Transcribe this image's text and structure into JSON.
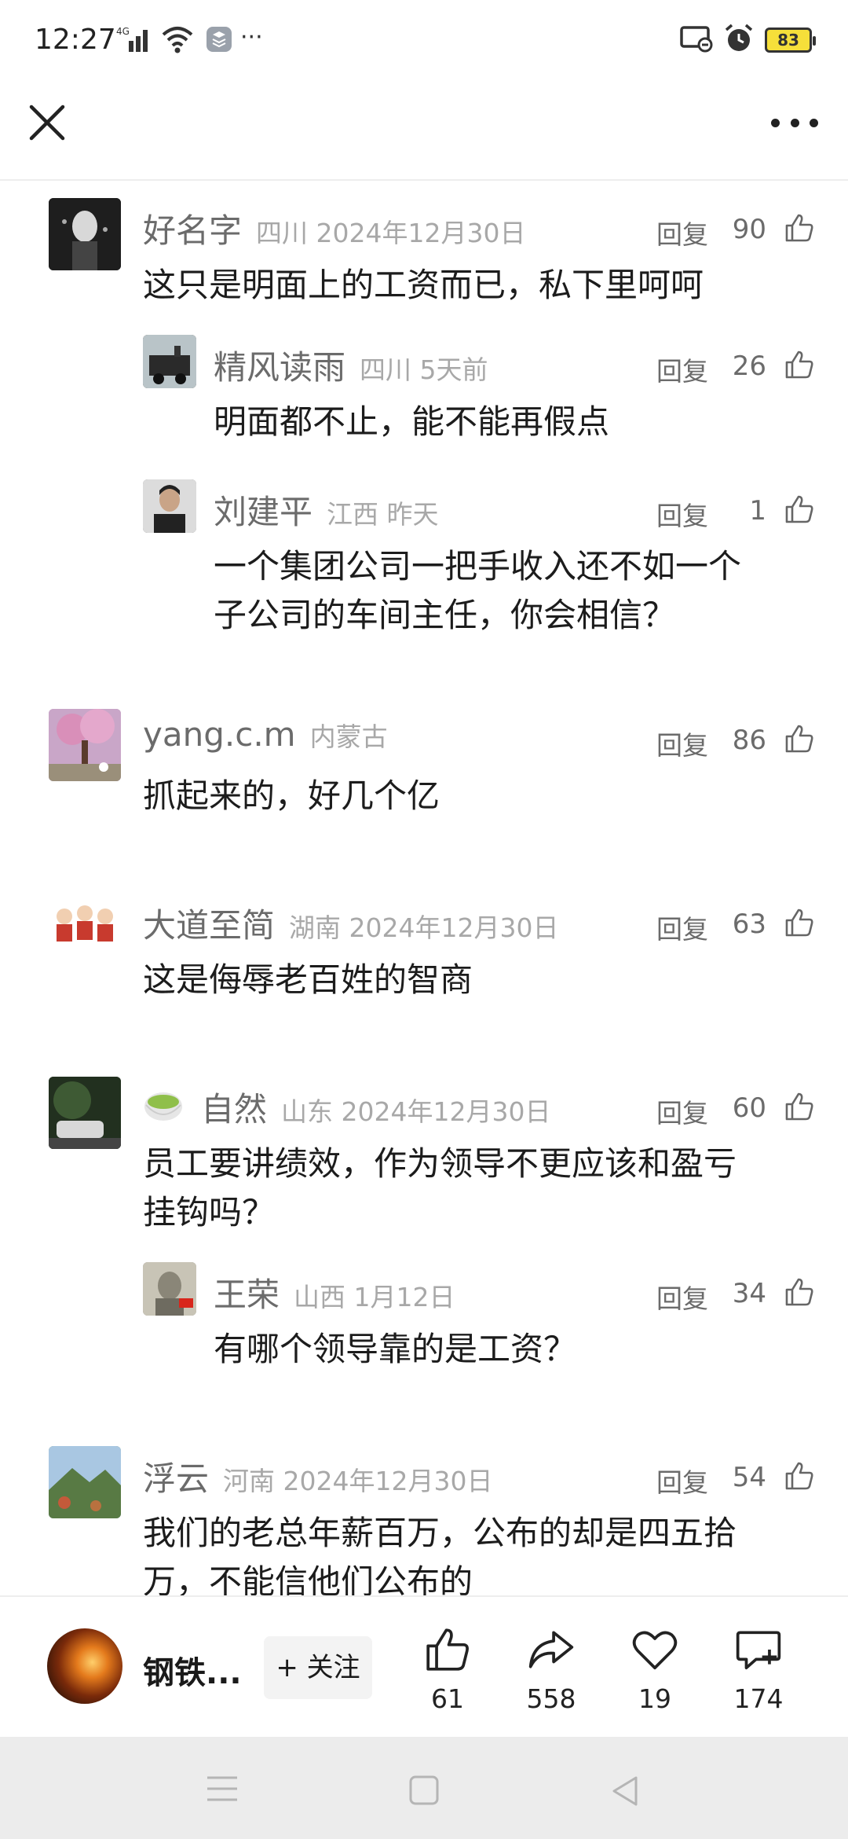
{
  "status_bar": {
    "time": "12:27",
    "network": "4G",
    "battery": "83"
  },
  "comments": [
    {
      "user": "好名字",
      "meta": "四川 2024年12月30日",
      "reply": "回复",
      "likes": "90",
      "text": "这只是明面上的工资而已，私下里呵呵",
      "is_reply": false,
      "avatar_color": "#2b2b2b"
    },
    {
      "user": "精风读雨",
      "meta": "四川 5天前",
      "reply": "回复",
      "likes": "26",
      "text": "明面都不止，能不能再假点",
      "is_reply": true,
      "avatar_color": "#5a4a3a"
    },
    {
      "user": "刘建平",
      "meta": "江西 昨天",
      "reply": "回复",
      "likes": "1",
      "text_lines": [
        "一个集团公司一把手收入还不如一个",
        "子公司的车间主任，你会相信？"
      ],
      "is_reply": true,
      "avatar_color": "#6e6e6e"
    },
    {
      "user": "yang.c.m",
      "meta": "内蒙古",
      "reply": "回复",
      "likes": "86",
      "text": "抓起来的，好几个亿",
      "is_reply": false,
      "avatar_color": "#b38ab0"
    },
    {
      "user": "大道至简",
      "meta": "湖南 2024年12月30日",
      "reply": "回复",
      "likes": "63",
      "text": "这是侮辱老百姓的智商",
      "is_reply": false,
      "avatar_color": "#c83a2e"
    },
    {
      "user": "自然",
      "meta": "山东 2024年12月30日",
      "reply": "回复",
      "likes": "60",
      "text_lines": [
        "员工要讲绩效，作为领导不更应该和盈亏",
        "挂钩吗？"
      ],
      "is_reply": false,
      "avatar_color": "#2f3a2c"
    },
    {
      "user": "王荣",
      "meta": "山西 1月12日",
      "reply": "回复",
      "likes": "34",
      "text": "有哪个领导靠的是工资？",
      "is_reply": true,
      "avatar_color": "#8b8a82"
    },
    {
      "user": "浮云",
      "meta": "河南 2024年12月30日",
      "reply": "回复",
      "likes": "54",
      "text_lines": [
        "我们的老总年薪百万，公布的却是四五拾",
        "万，不能信他们公布的"
      ],
      "is_reply": false,
      "avatar_color": "#6f8a5a"
    }
  ],
  "action_bar": {
    "account_name": "钢铁...",
    "follow_label": "+ 关注",
    "like_count": "61",
    "share_count": "558",
    "favorite_count": "19",
    "comment_count": "174"
  }
}
